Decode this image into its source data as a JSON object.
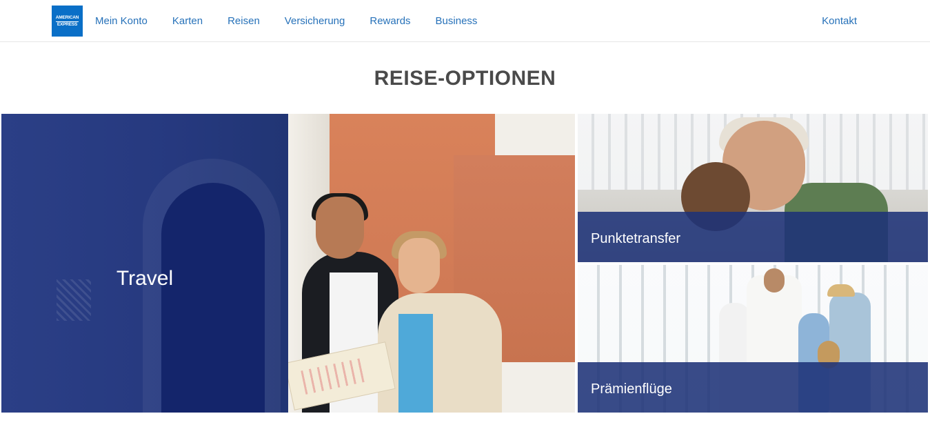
{
  "header": {
    "logo_line1": "AMERICAN",
    "logo_line2": "EXPRESS",
    "nav": [
      "Mein Konto",
      "Karten",
      "Reisen",
      "Versicherung",
      "Rewards",
      "Business"
    ],
    "contact": "Kontakt"
  },
  "main": {
    "title": "REISE-OPTIONEN",
    "tiles": {
      "travel": "Travel",
      "punktetransfer": "Punktetransfer",
      "praemienfluege": "Prämienflüge"
    }
  },
  "colors": {
    "link": "#2671b9",
    "brand_blue": "#0a6fc7",
    "overlay_blue": "#1e3278"
  }
}
